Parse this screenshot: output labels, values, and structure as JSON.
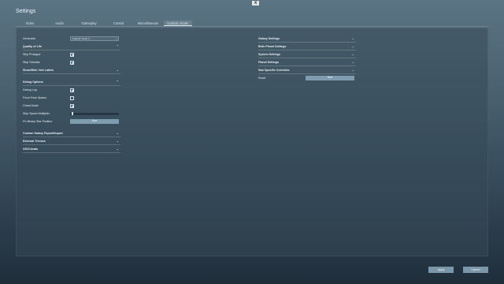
{
  "window": {
    "title": "Settings",
    "close_glyph": "X"
  },
  "tabs": [
    {
      "label": "Video"
    },
    {
      "label": "Audio"
    },
    {
      "label": "Gameplay"
    },
    {
      "label": "Control"
    },
    {
      "label": "Miscellaneous"
    },
    {
      "label": "Galactic Scale"
    }
  ],
  "active_tab": "Galactic Scale",
  "left": {
    "generator": {
      "label": "Generator",
      "value": "Galactic Scale 2"
    },
    "quality_of_life": {
      "title": "Quality of Life",
      "skip_prologue": {
        "label": "Skip Prologue",
        "checked": true
      },
      "skip_tutorials": {
        "label": "Skip Tutorials",
        "checked": true
      },
      "show_hide_vein_labels": "Show/Hide Vein Labels"
    },
    "debug_options": {
      "title": "Debug Options",
      "debug_log": {
        "label": "Debug Log",
        "checked": true
      },
      "force_rare_spawn": {
        "label": "Force Rare Spawn",
        "checked": false
      },
      "cheat_mode": {
        "label": "Cheat Mode",
        "checked": true
      },
      "ship_speed_multiplier": {
        "label": "Ship Speed Multiplier",
        "value": 0.05
      },
      "fix_binary_star_position": {
        "label": "Fix Binary Star Position",
        "button": "Now"
      }
    },
    "custom_galaxy_export_import": "Custom Galaxy Export/Import",
    "external_themes": "External Themes",
    "gs2_cheats": "GS2Cheats"
  },
  "right": {
    "galaxy_settings": "Galaxy Settings",
    "birth_planet_settings": "Birth Planet Settings",
    "system_settings": "System Settings",
    "planet_settings": "Planet Settings",
    "star_specific_overrides": "Star Specific Overrides",
    "reset": {
      "label": "Reset",
      "button": "Now"
    }
  },
  "footer": {
    "apply": "Apply",
    "cancel": "Cancel"
  },
  "colors": {
    "button": "#7f9cae",
    "panel": "#344856"
  }
}
